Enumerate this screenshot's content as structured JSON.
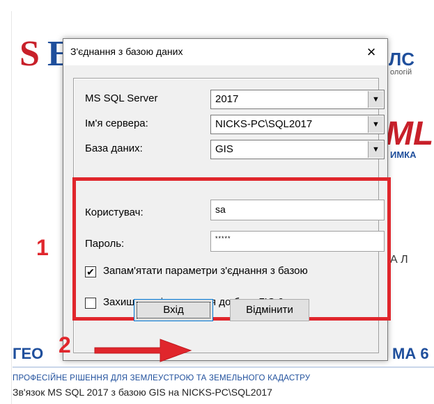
{
  "background": {
    "logo_s": "S",
    "logo_e": "E",
    "fragment_lc": "ЛС",
    "fragment_ologii": "ологій",
    "fragment_ml": "ML",
    "fragment_imka": "ИМКА",
    "fragment_al": "А Л",
    "fragment_geo": "ГЕО",
    "fragment_ma6": "МА 6",
    "tagline": "ПРОФЕСІЙНЕ РІШЕННЯ ДЛЯ ЗЕМЛЕУСТРОЮ ТА ЗЕМЕЛЬНОГО КАДАСТРУ",
    "status": "Зв'язок MS SQL 2017 з базою GIS на NICKS-PC\\SQL2017"
  },
  "dialog": {
    "title": "З'єднання з базою даних",
    "close_icon": "×",
    "fields": {
      "ms_sql_server_label": "MS SQL Server",
      "ms_sql_server_value": "2017",
      "server_name_label": "Ім'я сервера:",
      "server_name_value": "NICKS-PC\\SQL2017",
      "database_label": "База даних:",
      "database_value": "GIS",
      "user_label": "Користувач:",
      "user_value": "sa",
      "password_label": "Пароль:",
      "password_value": "*****"
    },
    "checkboxes": {
      "remember_label": "Запам'ятати параметри з'єднання з базою",
      "remember_checked": "✔",
      "secure_label": "Захищене підключення до бази ГІС 6"
    },
    "buttons": {
      "ok": "Вхід",
      "cancel": "Відмінити"
    }
  },
  "annotations": {
    "marker_1": "1",
    "marker_2": "2",
    "color": "#e0262c"
  }
}
